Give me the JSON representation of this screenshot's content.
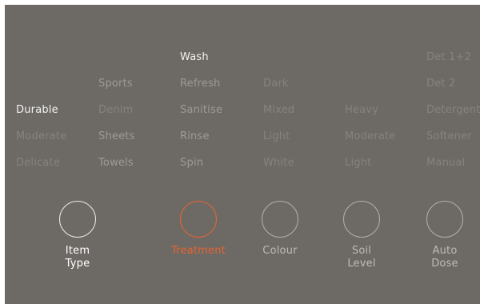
{
  "columns": {
    "item_type": {
      "options": [
        "Durable",
        "Moderate",
        "Delicate"
      ]
    },
    "treatment_left": {
      "options": [
        "Sports",
        "Denim",
        "Sheets",
        "Towels"
      ]
    },
    "treatment": {
      "options": [
        "Wash",
        "Refresh",
        "Sanitise",
        "Rinse",
        "Spin"
      ]
    },
    "colour": {
      "options": [
        "Dark",
        "Mixed",
        "Light",
        "White"
      ]
    },
    "soil_level": {
      "options": [
        "Heavy",
        "Moderate",
        "Light"
      ]
    },
    "auto_dose": {
      "options": [
        "Det 1+2",
        "Det 2",
        "Detergent",
        "Softener",
        "Manual"
      ]
    }
  },
  "knobs": [
    {
      "label": "Item\nType",
      "state": "active"
    },
    {
      "label": "Treatment",
      "state": "selected"
    },
    {
      "label": "Colour",
      "state": "dim"
    },
    {
      "label": "Soil\nLevel",
      "state": "dim"
    },
    {
      "label": "Auto\nDose",
      "state": "dim"
    }
  ],
  "colors": {
    "panel_bg": "#6d6a66",
    "accent_orange": "#e7632f",
    "active_text": "#f3f2f0",
    "dim_text": "#9e9a96",
    "faint_text": "#86827e"
  }
}
